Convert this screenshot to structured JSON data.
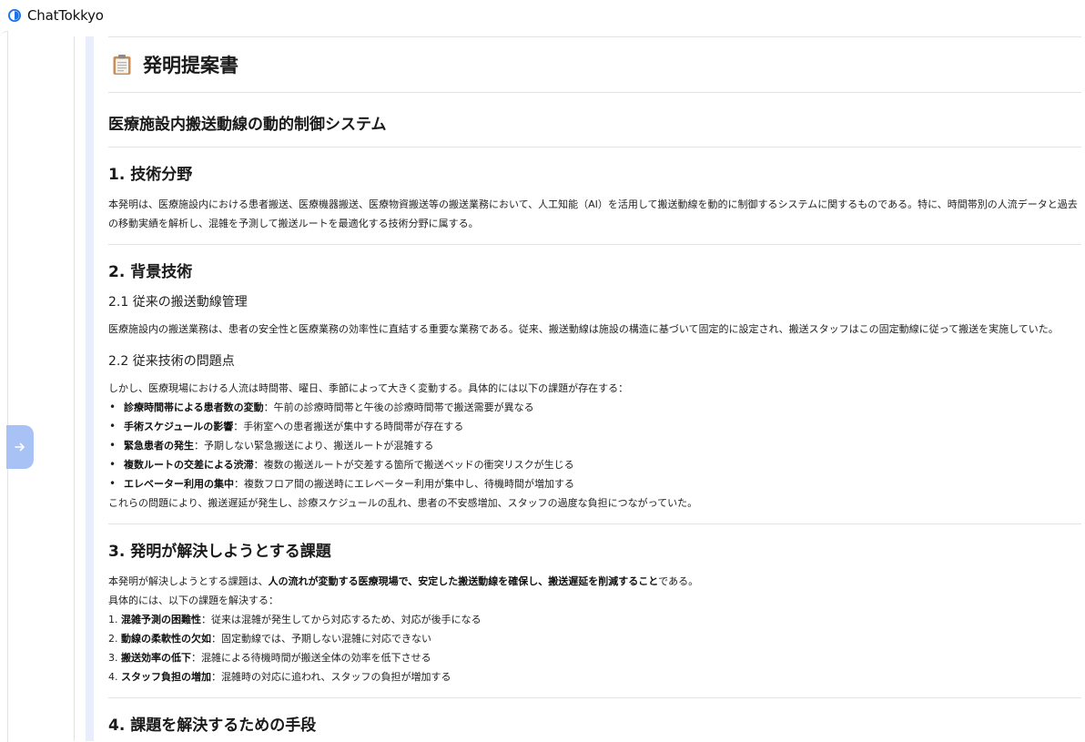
{
  "app": {
    "name": "ChatTokkyo"
  },
  "doc": {
    "header_title": "発明提案書",
    "invention_title": "医療施設内搬送動線の動的制御システム",
    "s1": {
      "heading": "1. 技術分野",
      "body": "本発明は、医療施設内における患者搬送、医療機器搬送、医療物資搬送等の搬送業務において、人工知能（AI）を活用して搬送動線を動的に制御するシステムに関するものである。特に、時間帯別の人流データと過去の移動実績を解析し、混雑を予測して搬送ルートを最適化する技術分野に属する。"
    },
    "s2": {
      "heading": "2. 背景技術",
      "sub1": "2.1 従来の搬送動線管理",
      "p1": "医療施設内の搬送業務は、患者の安全性と医療業務の効率性に直結する重要な業務である。従来、搬送動線は施設の構造に基づいて固定的に設定され、搬送スタッフはこの固定動線に従って搬送を実施していた。",
      "sub2": "2.2 従来技術の問題点",
      "p2": "しかし、医療現場における人流は時間帯、曜日、季節によって大きく変動する。具体的には以下の課題が存在する：",
      "bullets": [
        {
          "bold": "診療時間帯による患者数の変動",
          "text": "：午前の診療時間帯と午後の診療時間帯で搬送需要が異なる"
        },
        {
          "bold": "手術スケジュールの影響",
          "text": "：手術室への患者搬送が集中する時間帯が存在する"
        },
        {
          "bold": "緊急患者の発生",
          "text": "：予期しない緊急搬送により、搬送ルートが混雑する"
        },
        {
          "bold": "複数ルートの交差による渋滞",
          "text": "：複数の搬送ルートが交差する箇所で搬送ベッドの衝突リスクが生じる"
        },
        {
          "bold": "エレベーター利用の集中",
          "text": "：複数フロア間の搬送時にエレベーター利用が集中し、待機時間が増加する"
        }
      ],
      "p3": "これらの問題により、搬送遅延が発生し、診療スケジュールの乱れ、患者の不安感増加、スタッフの過度な負担につながっていた。"
    },
    "s3": {
      "heading": "3. 発明が解決しようとする課題",
      "intro_pre": "本発明が解決しようとする課題は、",
      "intro_bold": "人の流れが変動する医療現場で、安定した搬送動線を確保し、搬送遅延を削減すること",
      "intro_post": "である。",
      "p2": "具体的には、以下の課題を解決する：",
      "items": [
        {
          "num": "1.",
          "bold": "混雑予測の困難性",
          "text": "：従来は混雑が発生してから対応するため、対応が後手になる"
        },
        {
          "num": "2.",
          "bold": "動線の柔軟性の欠如",
          "text": "：固定動線では、予期しない混雑に対応できない"
        },
        {
          "num": "3.",
          "bold": "搬送効率の低下",
          "text": "：混雑による待機時間が搬送全体の効率を低下させる"
        },
        {
          "num": "4.",
          "bold": "スタッフ負担の増加",
          "text": "：混雑時の対応に追われ、スタッフの負担が増加する"
        }
      ]
    },
    "s4": {
      "heading": "4. 課題を解決するための手段"
    }
  },
  "colors": {
    "accent": "#1a73e8",
    "toggle_bg": "#a9c2f6",
    "rail": "#e8eefb"
  },
  "icons": {
    "logo": "chattokkyo-logo-icon",
    "document": "clipboard-icon",
    "toggle": "arrow-right-icon"
  }
}
